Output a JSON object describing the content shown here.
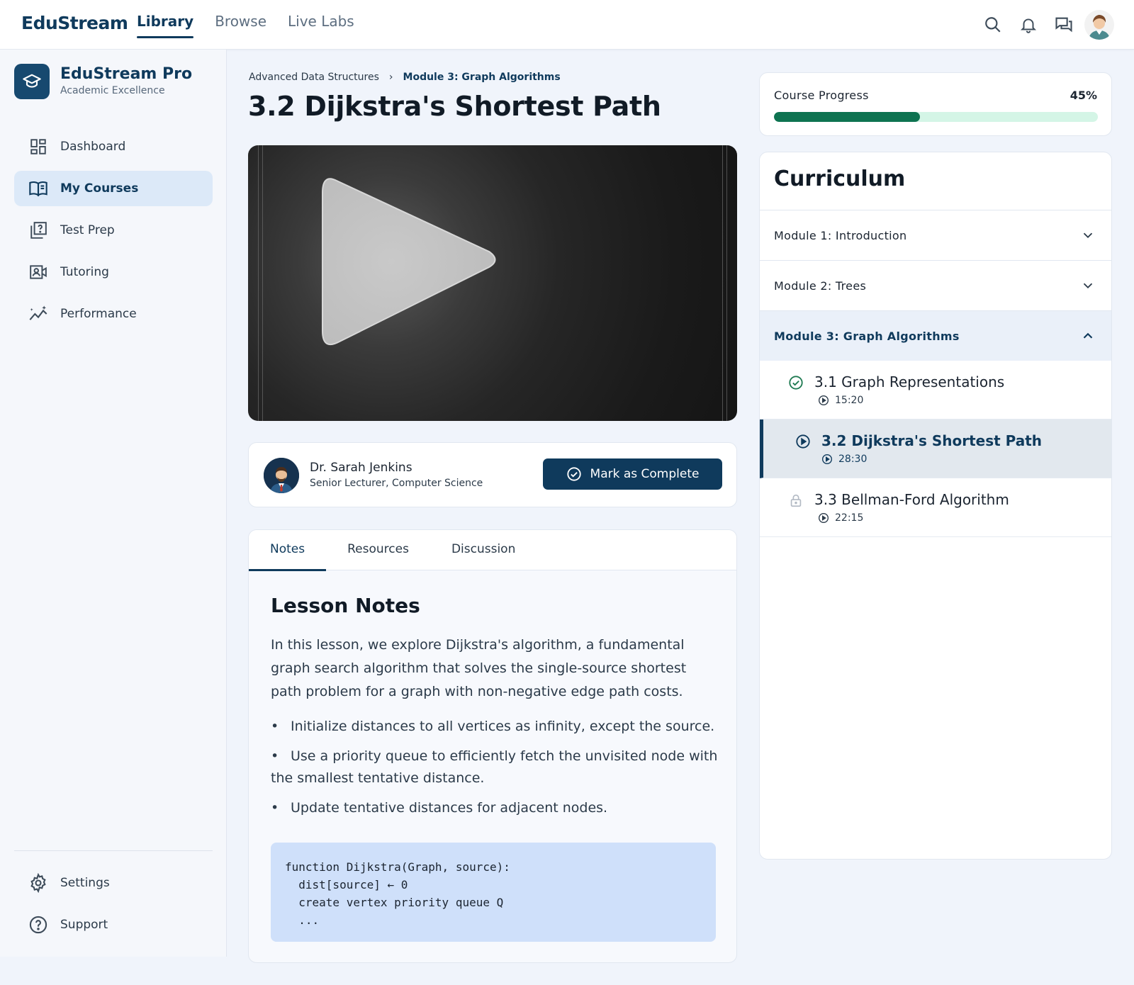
{
  "header": {
    "brand": "EduStream",
    "nav": [
      "Library",
      "Browse",
      "Live Labs"
    ],
    "active_nav": "Library",
    "icons": [
      "search-icon",
      "notification-bell-icon",
      "chat-icon",
      "user-avatar"
    ]
  },
  "sidebar": {
    "title": "EduStream Pro",
    "subtitle": "Academic Excellence",
    "items": [
      {
        "label": "Dashboard",
        "icon": "dashboard-icon"
      },
      {
        "label": "My Courses",
        "icon": "book-icon",
        "active": true
      },
      {
        "label": "Test Prep",
        "icon": "quiz-icon"
      },
      {
        "label": "Tutoring",
        "icon": "video-call-icon"
      },
      {
        "label": "Performance",
        "icon": "chart-icon"
      }
    ],
    "footer": [
      {
        "label": "Settings",
        "icon": "gear-icon"
      },
      {
        "label": "Support",
        "icon": "help-icon"
      }
    ]
  },
  "breadcrumb": {
    "parent": "Advanced Data Structures",
    "separator": "›",
    "current": "Module 3: Graph Algorithms"
  },
  "lesson": {
    "title": "3.2 Dijkstra's Shortest Path"
  },
  "instructor": {
    "name": "Dr. Sarah Jenkins",
    "role": "Senior Lecturer, Computer Science",
    "complete_label": "Mark as Complete"
  },
  "tabs": {
    "items": [
      "Notes",
      "Resources",
      "Discussion"
    ],
    "active": "Notes"
  },
  "notes": {
    "title": "Lesson Notes",
    "paragraph": "In this lesson, we explore Dijkstra's algorithm, a fundamental graph search algorithm that solves the single-source shortest path problem for a graph with non-negative edge path costs.",
    "bullets": [
      "Initialize distances to all vertices as infinity, except the source.",
      "Use a priority queue to efficiently fetch the unvisited node with the smallest tentative distance.",
      "Update tentative distances for adjacent nodes."
    ],
    "code": "function Dijkstra(Graph, source):\n  dist[source] ← 0\n  create vertex priority queue Q\n  ..."
  },
  "progress": {
    "label": "Course Progress",
    "percent_text": "45%",
    "value": 0.45,
    "fill_color": "#0e7351",
    "track_color": "#d4f5e6"
  },
  "curriculum": {
    "title": "Curriculum",
    "modules": [
      {
        "label": "Module 1: Introduction",
        "expanded": false
      },
      {
        "label": "Module 2: Trees",
        "expanded": false
      },
      {
        "label": "Module 3: Graph Algorithms",
        "expanded": true
      }
    ],
    "lessons": [
      {
        "title": "3.1 Graph Representations",
        "duration": "15:20",
        "status": "completed",
        "icon": "check-circle-icon"
      },
      {
        "title": "3.2 Dijkstra's Shortest Path",
        "duration": "28:30",
        "status": "current",
        "icon": "play-circle-icon"
      },
      {
        "title": "3.3 Bellman-Ford Algorithm",
        "duration": "22:15",
        "status": "locked",
        "icon": "lock-icon"
      }
    ]
  },
  "colors": {
    "primary": "#0f3a5c",
    "background": "#f0f4fb",
    "code_bg": "#cfe0fa",
    "active_nav_bg": "#dce9f8"
  }
}
